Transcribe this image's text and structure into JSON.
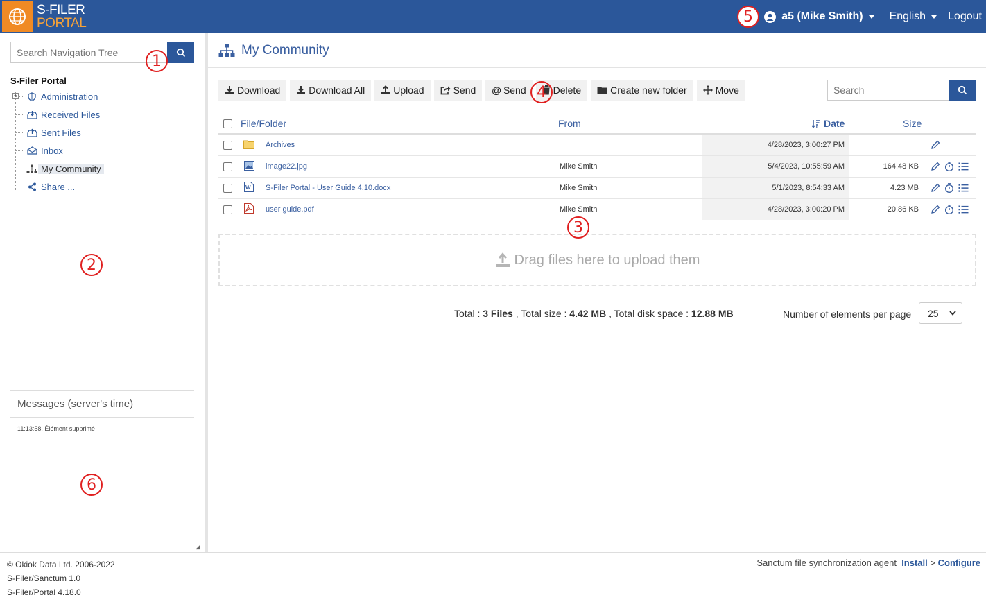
{
  "header": {
    "logo_line1": "S-FILER",
    "logo_line2": "PORTAL",
    "user": "a5 (Mike Smith)",
    "language": "English",
    "logout": "Logout",
    "brand_color": "#2b579a",
    "logo_color": "#f08a24"
  },
  "markers": [
    "1",
    "2",
    "3",
    "4",
    "5",
    "6"
  ],
  "sidebar": {
    "search_placeholder": "Search Navigation Tree",
    "tree_root": "S-Filer Portal",
    "items": [
      {
        "label": "Administration",
        "icon": "shield-icon"
      },
      {
        "label": "Received Files",
        "icon": "inbox-download-icon"
      },
      {
        "label": "Sent Files",
        "icon": "outbox-upload-icon"
      },
      {
        "label": "Inbox",
        "icon": "envelope-open-icon"
      },
      {
        "label": "My Community",
        "icon": "sitemap-icon"
      },
      {
        "label": "Share ...",
        "icon": "share-icon"
      }
    ],
    "messages_title": "Messages (server's time)",
    "messages": [
      "11:13:58, Élément supprimé"
    ]
  },
  "main": {
    "title": "My Community",
    "toolbar": {
      "download": "Download",
      "download_all": "Download All",
      "upload": "Upload",
      "send": "Send",
      "send_email": "Send",
      "delete": "Delete",
      "new_folder": "Create new folder",
      "move": "Move"
    },
    "search_placeholder": "Search",
    "columns": {
      "name": "File/Folder",
      "from": "From",
      "date": "Date",
      "size": "Size"
    },
    "rows": [
      {
        "name": "Archives",
        "from": "",
        "date": "4/28/2023, 3:00:27 PM",
        "size": "",
        "type": "folder"
      },
      {
        "name": "image22.jpg",
        "from": "Mike Smith",
        "date": "5/4/2023, 10:55:59 AM",
        "size": "164.48 KB",
        "type": "image"
      },
      {
        "name": "S-Filer Portal - User Guide 4.10.docx",
        "from": "Mike Smith",
        "date": "5/1/2023, 8:54:33 AM",
        "size": "4.23 MB",
        "type": "word"
      },
      {
        "name": "user guide.pdf",
        "from": "Mike Smith",
        "date": "4/28/2023, 3:00:20 PM",
        "size": "20.86 KB",
        "type": "pdf"
      }
    ],
    "dropzone": "Drag files here to upload them",
    "totals": {
      "files_label": "Total :",
      "files_value": "3 Files",
      "size_label": ", Total size :",
      "size_value": "4.42 MB",
      "disk_label": ", Total disk space :",
      "disk_value": "12.88 MB"
    },
    "per_page_label": "Number of elements per page",
    "per_page_value": "25"
  },
  "footer": {
    "copyright": "© Okiok Data Ltd. 2006-2022",
    "version1": "S-Filer/Sanctum 1.0",
    "version2": "S-Filer/Portal 4.18.0",
    "agent_text": "Sanctum file synchronization agent",
    "install": "Install",
    "sep": ">",
    "configure": "Configure"
  }
}
